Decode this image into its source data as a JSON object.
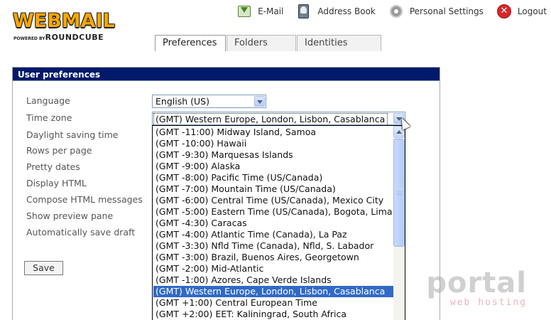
{
  "logo": {
    "title": "WEBMAIL",
    "powered_small": "POWERED BY",
    "powered_brand": "ROUNDCUBE"
  },
  "topnav": {
    "email": "E-Mail",
    "address_book": "Address Book",
    "personal_settings": "Personal Settings",
    "logout": "Logout"
  },
  "tabs": {
    "preferences": "Preferences",
    "folders": "Folders",
    "identities": "Identities",
    "active": "Preferences"
  },
  "prefs": {
    "header": "User preferences",
    "labels": {
      "language": "Language",
      "time_zone": "Time zone",
      "daylight": "Daylight saving time",
      "rows": "Rows per page",
      "pretty_dates": "Pretty dates",
      "display_html": "Display HTML",
      "compose_html": "Compose HTML messages",
      "preview_pane": "Show preview pane",
      "autosave": "Automatically save draft"
    },
    "language_value": "English (US)",
    "timezone_value": "(GMT) Western Europe, London, Lisbon, Casablanca",
    "save_label": "Save"
  },
  "timezone_options": [
    "(GMT -11:00) Midway Island, Samoa",
    "(GMT -10:00) Hawaii",
    "(GMT -9:30) Marquesas Islands",
    "(GMT -9:00) Alaska",
    "(GMT -8:00) Pacific Time (US/Canada)",
    "(GMT -7:00) Mountain Time (US/Canada)",
    "(GMT -6:00) Central Time (US/Canada), Mexico City",
    "(GMT -5:00) Eastern Time (US/Canada), Bogota, Lima",
    "(GMT -4:30) Caracas",
    "(GMT -4:00) Atlantic Time (Canada), La Paz",
    "(GMT -3:30) Nfld Time (Canada), Nfld, S. Labador",
    "(GMT -3:00) Brazil, Buenos Aires, Georgetown",
    "(GMT -2:00) Mid-Atlantic",
    "(GMT -1:00) Azores, Cape Verde Islands",
    "(GMT) Western Europe, London, Lisbon, Casablanca",
    "(GMT +1:00) Central European Time",
    "(GMT +2:00) EET: Kaliningrad, South Africa"
  ],
  "timezone_selected_index": 14,
  "watermark": {
    "main": "portal",
    "sub": "web hosting"
  },
  "colors": {
    "header_bg": "#001a6b",
    "selection": "#316ac5",
    "logo_orange": "#f7a600"
  },
  "icons": {
    "email": "email-icon",
    "address_book": "address-book-icon",
    "settings": "gear-icon",
    "logout": "logout-icon"
  }
}
